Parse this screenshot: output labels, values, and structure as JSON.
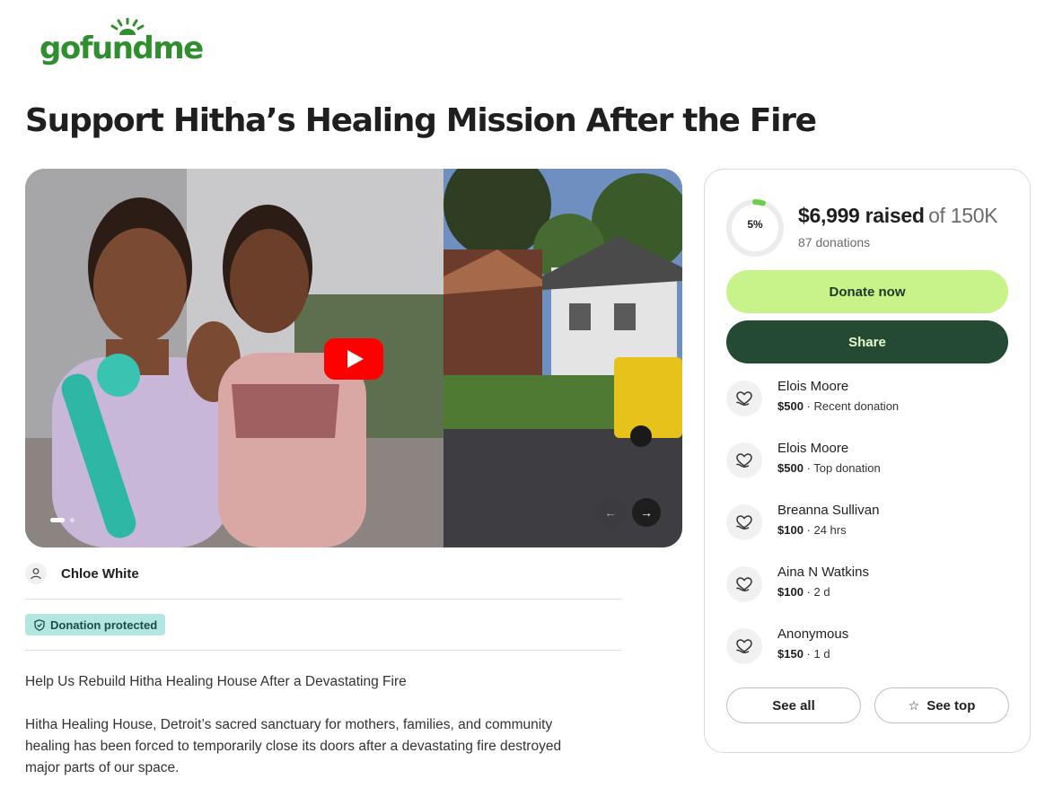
{
  "brand": {
    "logo_text": "gofundme"
  },
  "campaign": {
    "title": "Support Hitha’s Healing Mission After the Fire"
  },
  "media": {
    "slide_count": 2,
    "active_slide": 1
  },
  "organizer": {
    "name": "Chloe White"
  },
  "badge": {
    "label": "Donation protected"
  },
  "description": {
    "heading": "Help Us Rebuild Hitha Healing House After a Devastating Fire",
    "lines": [
      "Hitha Healing House, Detroit’s sacred sanctuary for mothers, families, and community",
      "healing has been forced to temporarily close its doors after a devastating fire destroyed",
      "major parts of our space."
    ]
  },
  "progress": {
    "percent_label": "5%",
    "percent_value": 0.05,
    "raised_label": "$6,999 raised",
    "goal_label": "of 150K",
    "donations_label": "87 donations"
  },
  "actions": {
    "donate_label": "Donate now",
    "share_label": "Share"
  },
  "donors": [
    {
      "name": "Elois Moore",
      "amount": "$500",
      "note": " · Recent donation"
    },
    {
      "name": "Elois Moore",
      "amount": "$500",
      "note": " · Top donation"
    },
    {
      "name": "Breanna Sullivan",
      "amount": "$100",
      "note": " · 24 hrs"
    },
    {
      "name": "Aina N Watkins",
      "amount": "$100",
      "note": " · 2 d"
    },
    {
      "name": "Anonymous",
      "amount": "$150",
      "note": " · 1 d"
    }
  ],
  "list_actions": {
    "see_all_label": "See all",
    "see_top_label": "See top"
  },
  "colors": {
    "brand_green": "#2f8f2f",
    "donate_button": "#c8f28a",
    "share_button": "#254a33",
    "badge_bg": "#b3e6e0",
    "youtube_red": "#ff0000"
  },
  "icons": {
    "organizer": "user-icon",
    "badge": "shield-icon",
    "donor": "heart-hand-icon",
    "see_top": "star-icon",
    "carousel_prev": "arrow-left-icon",
    "carousel_next": "arrow-right-icon"
  }
}
